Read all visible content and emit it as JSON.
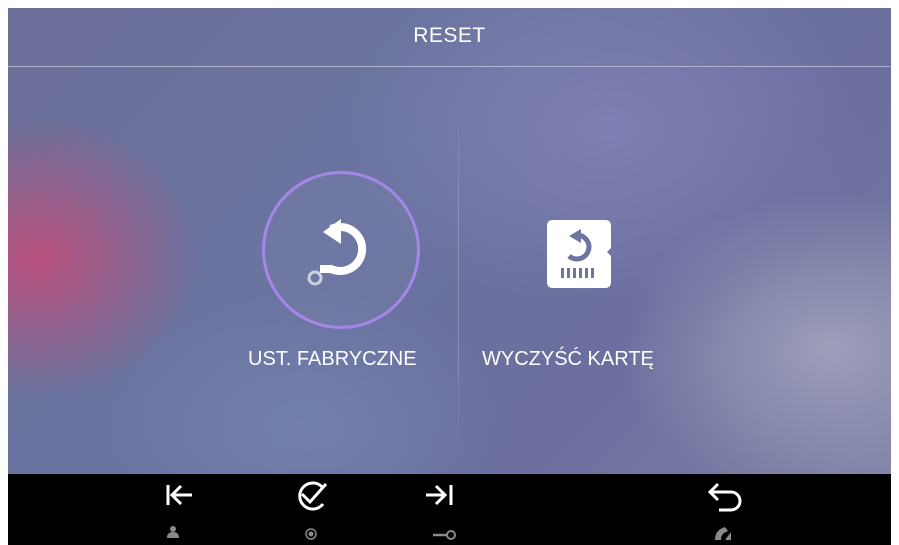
{
  "header": {
    "title": "RESET"
  },
  "options": [
    {
      "label": "UST. FABRYCZNE",
      "icon": "factory-reset-icon"
    },
    {
      "label": "WYCZYŚĆ KARTĘ",
      "icon": "clear-card-icon"
    }
  ],
  "bottom_bar": {
    "keys": [
      {
        "icon": "arrow-left-to-bar-icon",
        "sub_icon": "person-icon"
      },
      {
        "icon": "check-circle-icon",
        "sub_icon": "record-dot-icon"
      },
      {
        "icon": "arrow-right-to-bar-icon",
        "sub_icon": "key-icon"
      },
      {
        "icon": "back-arrow-icon",
        "sub_icon": "handset-icon"
      }
    ]
  },
  "colors": {
    "accent_ring": "#a487e8",
    "bottom_bar": "#000000",
    "text": "#ffffff"
  }
}
